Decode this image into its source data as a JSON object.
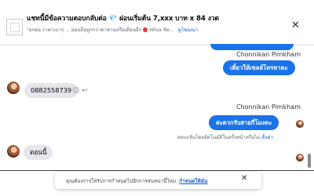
{
  "header": {
    "title_text": "แชทนี้มีข้อความตอบกลับต่อ",
    "title_gem": "💎",
    "title_promo": "ผ่อนเริ่มต้น 7,xxx บาท x 84 งวด",
    "subtitle": "\"ยกต่อ ราคาเบาๆ ... ผ่อนถือถูกกว่าค่าชานหรือเดือนอีก",
    "subtitle_tail": "Hilux Re...",
    "link_label": "ดูโฆษณา",
    "close_icon": "close-icon"
  },
  "messages": {
    "sender_name_1": "Chonnikan Pimkham",
    "out_1": "เดี๋ยวให้เซลล์โทรหาคะ",
    "in_phone": "0882558739",
    "sender_name_2": "Chonnikan Pimkham",
    "out_2": "สะดวกรับสายกี่โมงคะ",
    "notice_text": "ตอบกลับโดยอัตโนมัติในครั้งหน้าหรือไม่",
    "notice_link": "ตั้งค่า",
    "in_last": "ตอนนี้"
  },
  "cookie_banner": {
    "text": "คุณต้องการใส่รับการกำหนดไปอีกการสนทนานี้ไหม",
    "link": "กำหนดให้ฉัน",
    "close_icon": "close-icon"
  },
  "colors": {
    "accent": "#1a73e8",
    "bubble_in": "#e4e6eb",
    "link": "#1a5fcc"
  }
}
